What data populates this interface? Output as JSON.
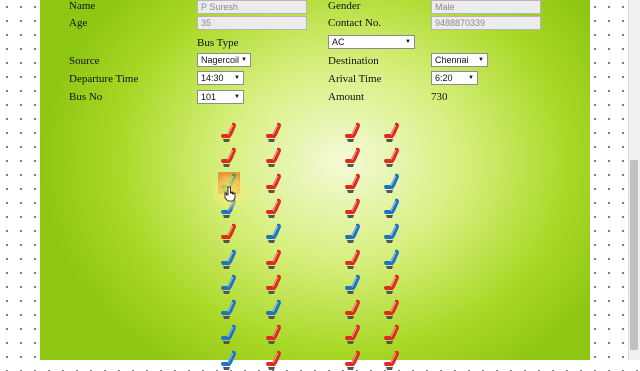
{
  "form": {
    "name_label": "Name",
    "name_value": "P Suresh",
    "gender_label": "Gender",
    "gender_value": "Male",
    "age_label": "Age",
    "age_value": "35",
    "contact_label": "Contact No.",
    "contact_value": "9488870339",
    "bus_type_label": "Bus Type",
    "bus_type_value": "AC",
    "source_label": "Source",
    "source_value": "Nagercoil",
    "destination_label": "Destination",
    "destination_value": "Chennai",
    "departure_label": "Departure Time",
    "departure_value": "14:30",
    "arrival_label": "Arival Time",
    "arrival_value": "6:20",
    "bus_no_label": "Bus No",
    "bus_no_value": "101",
    "amount_label": "Amount",
    "amount_value": "730"
  },
  "seat_map": {
    "colors": {
      "booked": "#e02a1c",
      "available": "#1e73c9",
      "selected": "#e59a3a",
      "selected_accent": "#2c9a40"
    },
    "columns": [
      [
        "booked",
        "booked",
        "selected",
        "available",
        "booked",
        "available",
        "available",
        "available",
        "available",
        "available"
      ],
      [
        "booked",
        "booked",
        "booked",
        "booked",
        "available",
        "booked",
        "booked",
        "available",
        "booked",
        "booked"
      ],
      [
        "booked",
        "booked",
        "booked",
        "booked",
        "available",
        "booked",
        "available",
        "booked",
        "booked",
        "booked"
      ],
      [
        "booked",
        "booked",
        "available",
        "available",
        "available",
        "available",
        "booked",
        "booked",
        "booked",
        "booked"
      ]
    ]
  }
}
